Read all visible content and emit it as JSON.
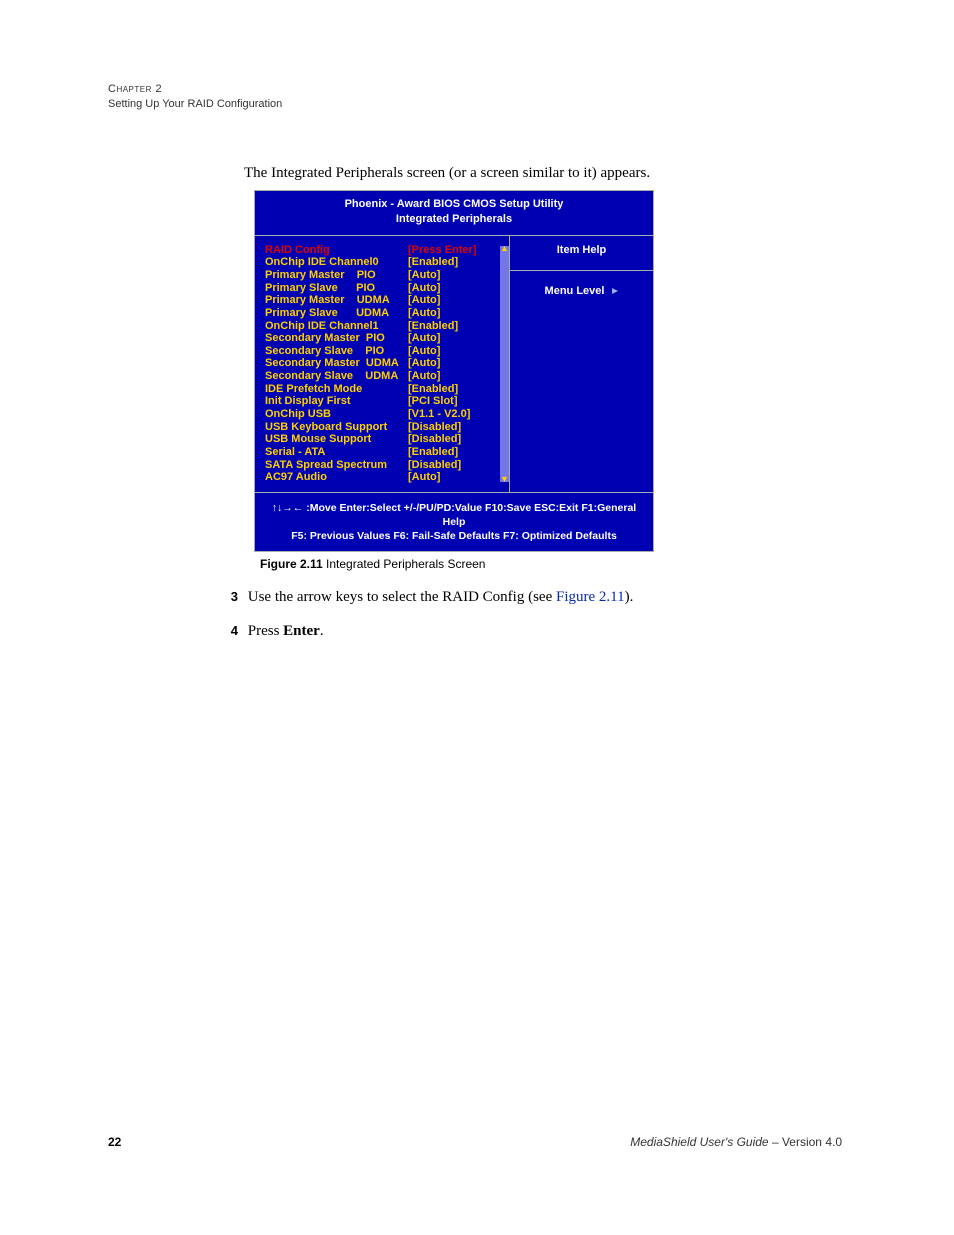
{
  "header": {
    "chapter": "Chapter 2",
    "section": "Setting Up Your RAID Configuration"
  },
  "intro": "The Integrated Peripherals screen (or a screen similar to it) appears.",
  "bios": {
    "title1": "Phoenix - Award BIOS CMOS Setup Utility",
    "title2": "Integrated Peripherals",
    "rows": [
      {
        "label": "RAID Config",
        "value": "[Press Enter]",
        "highlight": true
      },
      {
        "label": "OnChip IDE Channel0",
        "value": "[Enabled]"
      },
      {
        "label": "Primary Master    PIO",
        "value": "[Auto]"
      },
      {
        "label": "Primary Slave      PIO",
        "value": "[Auto]"
      },
      {
        "label": "Primary Master    UDMA",
        "value": "[Auto]"
      },
      {
        "label": "Primary Slave      UDMA",
        "value": "[Auto]"
      },
      {
        "label": "OnChip IDE Channel1",
        "value": "[Enabled]"
      },
      {
        "label": "Secondary Master  PIO",
        "value": "[Auto]"
      },
      {
        "label": "Secondary Slave    PIO",
        "value": "[Auto]"
      },
      {
        "label": "Secondary Master  UDMA",
        "value": "[Auto]"
      },
      {
        "label": "Secondary Slave    UDMA",
        "value": "[Auto]"
      },
      {
        "label": "IDE Prefetch Mode",
        "value": "[Enabled]"
      },
      {
        "label": "Init Display First",
        "value": "[PCI Slot]"
      },
      {
        "label": "OnChip USB",
        "value": "[V1.1 - V2.0]"
      },
      {
        "label": "USB Keyboard Support",
        "value": "[Disabled]"
      },
      {
        "label": "USB Mouse Support",
        "value": "[Disabled]"
      },
      {
        "label": "Serial - ATA",
        "value": "[Enabled]"
      },
      {
        "label": "SATA Spread Spectrum",
        "value": "[Disabled]"
      },
      {
        "label": "AC97 Audio",
        "value": "[Auto]"
      }
    ],
    "help_title": "Item Help",
    "menu_level": "Menu Level",
    "footer1": "↑↓→← :Move  Enter:Select   +/-/PU/PD:Value   F10:Save  ESC:Exit  F1:General Help",
    "footer2": "F5: Previous Values      F6: Fail-Safe Defaults      F7: Optimized Defaults"
  },
  "caption": {
    "label": "Figure 2.11",
    "text": "   Integrated Peripherals Screen"
  },
  "steps": {
    "s3": {
      "num": "3",
      "pre": "Use the arrow keys to select the RAID Config (see ",
      "xref": "Figure 2.11",
      "post": ")."
    },
    "s4": {
      "num": "4",
      "pre": "Press ",
      "bold": "Enter",
      "post": "."
    }
  },
  "footer": {
    "page": "22",
    "title": "MediaShield User's Guide",
    "sep": " – ",
    "version": "Version 4.0"
  }
}
